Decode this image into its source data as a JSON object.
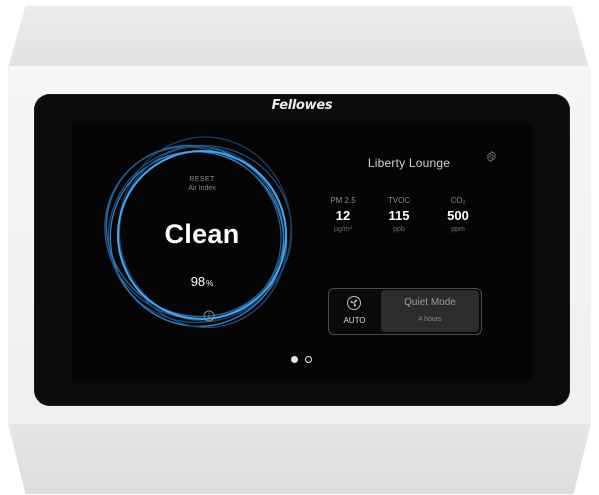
{
  "brand": {
    "name": "Fellowes"
  },
  "air_index": {
    "reset_label": "RESET",
    "title_label": "Air Index",
    "status": "Clean",
    "percent_value": "98",
    "percent_unit": "%",
    "level": 0.98,
    "info_icon": "info-icon",
    "ring_color": "#3fa0e8"
  },
  "room": {
    "name": "Liberty Lounge",
    "settings_icon": "gear-icon"
  },
  "metrics": [
    {
      "label": "PM 2.5",
      "value": "12",
      "unit": "µg/m³"
    },
    {
      "label": "TVOC",
      "value": "115",
      "unit": "ppb"
    },
    {
      "label": "CO₂",
      "value": "500",
      "unit": "ppm"
    }
  ],
  "modes": {
    "auto": {
      "label": "AUTO",
      "icon": "auto-fan-icon"
    },
    "quiet": {
      "title": "Quiet Mode",
      "subtitle": "4 hours",
      "selected": true
    }
  },
  "pager": {
    "pages": 2,
    "current": 1
  }
}
